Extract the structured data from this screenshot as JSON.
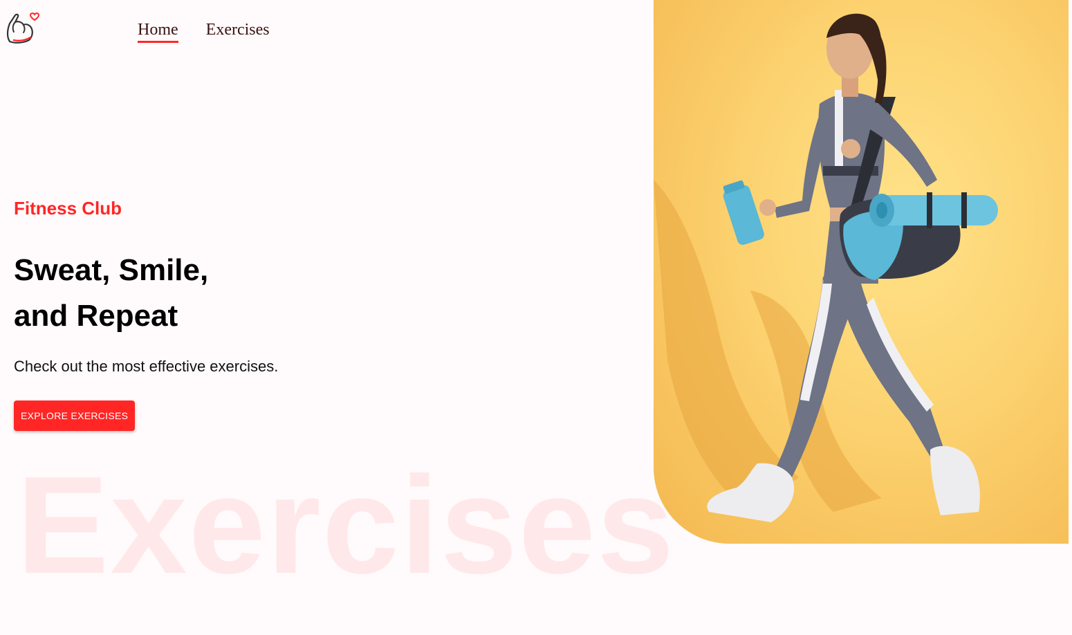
{
  "nav": {
    "items": [
      {
        "label": "Home",
        "active": true
      },
      {
        "label": "Exercises",
        "active": false
      }
    ]
  },
  "hero": {
    "tagline": "Fitness Club",
    "headline_line1": "Sweat, Smile,",
    "headline_line2": "and Repeat",
    "subtext": "Check out the most effective exercises.",
    "cta_label": "EXPLORE EXERCISES",
    "watermark": "Exercises"
  },
  "icons": {
    "logo": "flexed-arm-heart-icon"
  },
  "colors": {
    "accent": "#ff2625",
    "background": "#fffafb",
    "banner": "#fcd270",
    "nav_text": "#3a1212"
  }
}
